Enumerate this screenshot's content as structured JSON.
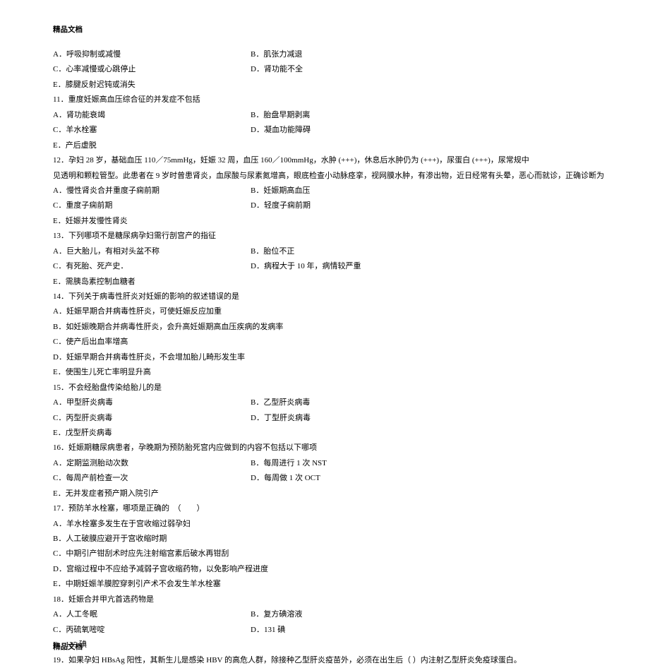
{
  "header": "精品文档",
  "footer": "精品文档",
  "lines": [
    {
      "left": "A．呼吸抑制或减慢",
      "right": "B．肌张力减退"
    },
    {
      "left": "C．心率减慢或心跳停止",
      "right": "D．肾功能不全"
    },
    {
      "full": "E．膝腱反射迟钝或消失"
    },
    {
      "full": "11．重度妊娠高血压综合征的并发症不包括"
    },
    {
      "left": "A．肾功能衰竭",
      "right": "B．胎盘早期剥离"
    },
    {
      "left": "C．羊水栓塞",
      "right": "D．凝血功能障碍"
    },
    {
      "full": "E．产后虚脱"
    },
    {
      "full": "12．孕妇 28 岁，基础血压 110／75mmHg，妊娠 32 周，血压 160／100mmHg，水肿 (+++)，休息后水肿仍为 (+++)，尿蛋白 (+++)，尿常规中"
    },
    {
      "full": "见透明和颗粒管型。此患者在 9 岁时曾患肾炎，血尿酸与尿素氮增高，眼底检查小动脉痉挛，视网膜水肿，有渗出物，近日经常有头晕，恶心而就诊，正确诊断为"
    },
    {
      "left": "A．慢性肾炎合并重度子痫前期",
      "right": "B．妊娠期高血压"
    },
    {
      "left": "C．重度子痫前期",
      "right": "D．轻度子痫前期"
    },
    {
      "full": "E．妊娠并发慢性肾炎"
    },
    {
      "full": "13．下列哪项不是糖尿病孕妇需行剖宫产的指征"
    },
    {
      "left": "A．巨大胎儿，有相对头盆不称",
      "right": "B．胎位不正"
    },
    {
      "left": "C．有死胎、死产史．",
      "right": "D．病程大于 10 年，病情较严重"
    },
    {
      "full": "E．需胰岛素控制血糖者"
    },
    {
      "full": "14．下列关于病毒性肝炎对妊娠的影响的叙述错误的是"
    },
    {
      "full": "A．妊娠早期合并病毒性肝炎，可使妊娠反应加重"
    },
    {
      "full": "B．如妊娠晚期合并病毒性肝炎，会升高妊娠期高血压疾病的发病率"
    },
    {
      "full": "C．使产后出血率增高"
    },
    {
      "full": "D．妊娠早期合并病毒性肝炎，不会增加胎儿畸形发生率"
    },
    {
      "full": "E．使围生儿死亡率明显升高"
    },
    {
      "full": "15．不会经胎盘传染给胎儿的是"
    },
    {
      "left": "A．甲型肝炎病毒",
      "right": "B．乙型肝炎病毒"
    },
    {
      "left": "C．丙型肝炎病毒",
      "right": "D．丁型肝炎病毒"
    },
    {
      "full": "E．戊型肝炎病毒"
    },
    {
      "full": "16．妊娠期糖尿病患者，孕晚期为预防胎死宫内应做到的内容不包括以下哪项"
    },
    {
      "left": "A．定期监测胎动次数",
      "right": "B．每周进行 1 次 NST"
    },
    {
      "left": "C．每周产前检查一次",
      "right": "D．每周做 1 次 OCT"
    },
    {
      "full": "E．无并发症者预产期入院引产"
    },
    {
      "full": "17．预防羊水栓塞，哪项是正确的　（　　）"
    },
    {
      "full": "A．羊水栓塞多发生在于宫收缩过弱孕妇"
    },
    {
      "full": "B．人工破膜应避开于宫收缩时期"
    },
    {
      "full": "C．中期引产钳刮术时应先注射缩宫素后破水再钳刮"
    },
    {
      "full": "D．宫缩过程中不应给予减弱子宫收缩药物，以免影响产程进度"
    },
    {
      "full": "E．中期妊娠羊膜腔穿刺引产术不会发生羊水栓塞"
    },
    {
      "full": "18．妊娠合并甲亢首选药物是"
    },
    {
      "left": "A．人工冬眠",
      "right": "B．复方碘溶液"
    },
    {
      "left": "C．丙硫氧嘧啶",
      "right": "D．131 碘"
    },
    {
      "full": "E．125 碘"
    },
    {
      "full": "19．如果孕妇 HBsAg 阳性，其新生儿是感染 HBV 的高危人群，除接种乙型肝炎疫苗外，必须在出生后（ ）内注射乙型肝炎免疫球蛋白。"
    }
  ]
}
